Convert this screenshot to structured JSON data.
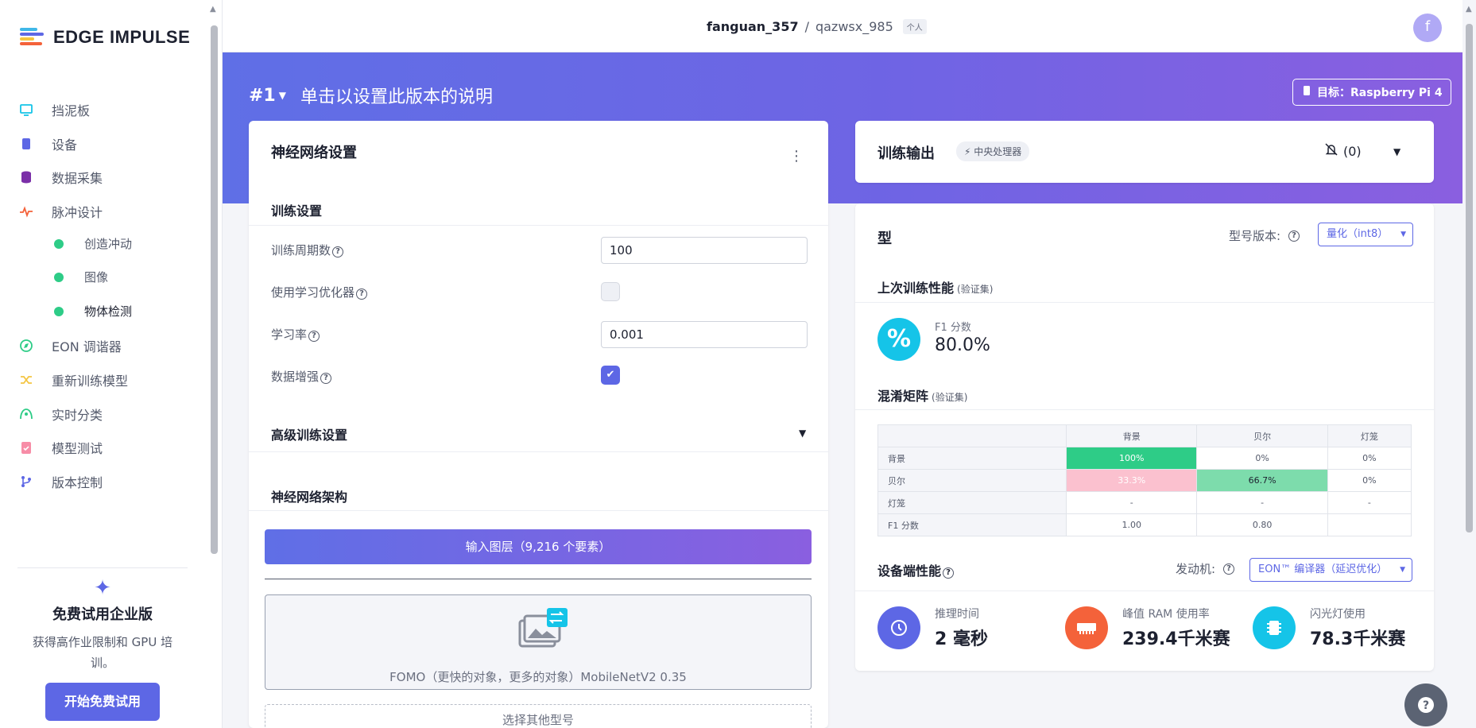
{
  "sidebar": {
    "brand": "EDGE IMPULSE",
    "items": [
      {
        "label": "挡泥板",
        "icon": "monitor-icon"
      },
      {
        "label": "设备",
        "icon": "chip-icon"
      },
      {
        "label": "数据采集",
        "icon": "database-icon"
      },
      {
        "label": "脉冲设计",
        "icon": "pulse-icon"
      },
      {
        "label": "EON 调谐器",
        "icon": "compass-icon"
      },
      {
        "label": "重新训练模型",
        "icon": "shuffle-icon"
      },
      {
        "label": "实时分类",
        "icon": "live-icon"
      },
      {
        "label": "模型测试",
        "icon": "clipboard-check-icon"
      },
      {
        "label": "版本控制",
        "icon": "branch-icon"
      }
    ],
    "sub_items": [
      {
        "label": "创造冲动"
      },
      {
        "label": "图像"
      },
      {
        "label": "物体检测"
      }
    ],
    "trial": {
      "title": "免费试用企业版",
      "text": "获得高作业限制和 GPU 培训。",
      "button": "开始免费试用"
    }
  },
  "topbar": {
    "user": "fanguan_357",
    "separator": "/",
    "project": "qazwsx_985",
    "tag": "个人",
    "avatar_letter": "f"
  },
  "hero": {
    "version": "#1",
    "description": "单击以设置此版本的说明",
    "target": "目标：Raspberry Pi 4"
  },
  "nn_settings": {
    "title": "神经网络设置",
    "training_section": "训练设置",
    "epochs_label": "训练周期数",
    "epochs_value": "100",
    "optimizer_label": "使用学习优化器",
    "optimizer_checked": false,
    "lr_label": "学习率",
    "lr_value": "0.001",
    "augment_label": "数据增强",
    "augment_checked": true,
    "advanced_section": "高级训练设置",
    "arch_section": "神经网络架构",
    "input_layer": "输入图层（9,216 个要素）",
    "model_name": "FOMO（更快的对象，更多的对象）MobileNetV2 0.35",
    "other_model": "选择其他型号"
  },
  "training_output": {
    "title": "训练输出",
    "processor": "中央处理器",
    "notifications": "(0)"
  },
  "model": {
    "title": "型",
    "version_label": "型号版本:",
    "version_value": "量化（int8）",
    "last_perf_title": "上次训练性能",
    "last_perf_note": "(验证集)",
    "f1_label": "F1 分数",
    "f1_value": "80.0%",
    "cm_title": "混淆矩阵",
    "cm_note": "(验证集)",
    "cm_headers": [
      "",
      "背景",
      "贝尔",
      "灯笼"
    ],
    "cm_rows": [
      [
        "背景",
        "100%",
        "0%",
        "0%"
      ],
      [
        "贝尔",
        "33.3%",
        "66.7%",
        "0%"
      ],
      [
        "灯笼",
        "-",
        "-",
        "-"
      ],
      [
        "F1 分数",
        "1.00",
        "0.80",
        ""
      ]
    ],
    "device_title": "设备端性能",
    "engine_label": "发动机:",
    "engine_value": "EON™ 编译器（延迟优化）",
    "perf": [
      {
        "label": "推理时间",
        "value": "2 毫秒",
        "color": "#5d67e5",
        "icon": "clock-icon"
      },
      {
        "label": "峰值 RAM 使用率",
        "value": "239.4千米赛",
        "color": "#f4623a",
        "icon": "ram-icon"
      },
      {
        "label": "闪光灯使用",
        "value": "78.3千米赛",
        "color": "#15c4e8",
        "icon": "flash-chip-icon"
      }
    ]
  },
  "colors": {
    "accent": "#5d67e5",
    "cm_green": "#2ecc87",
    "cm_green_light": "#7ddcac",
    "cm_pink": "#fbc1cf"
  }
}
